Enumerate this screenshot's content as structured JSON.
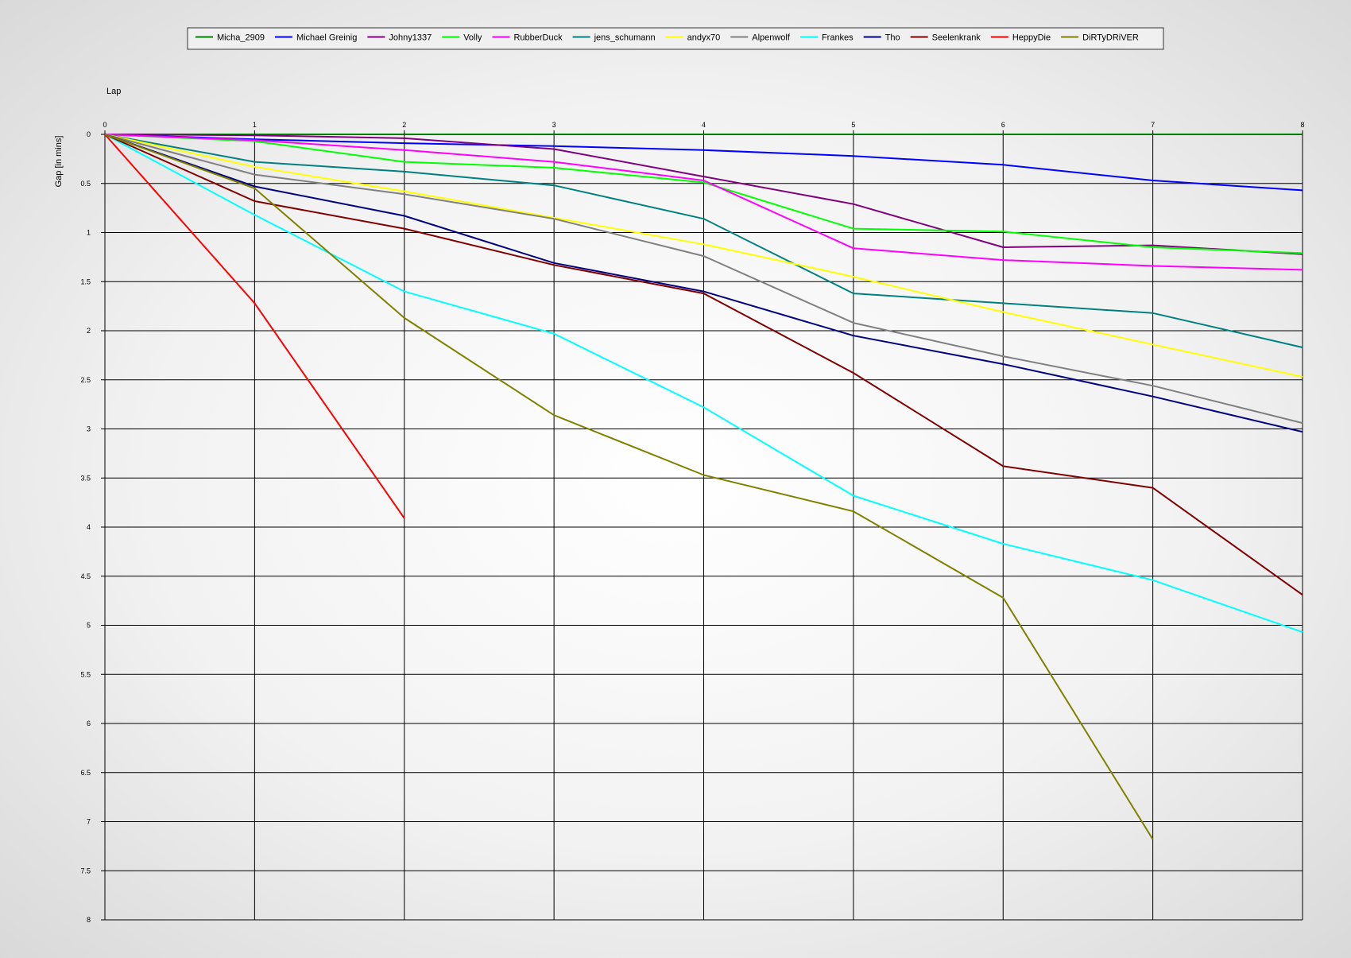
{
  "chart_data": {
    "type": "line",
    "title": "",
    "xlabel": "Lap",
    "ylabel": "Gap [in mins]",
    "xlim": [
      0,
      8
    ],
    "ylim": [
      0,
      8
    ],
    "y_inverted": true,
    "grid": true,
    "legend_position": "top-center",
    "x_ticks": [
      0,
      1,
      2,
      3,
      4,
      5,
      6,
      7,
      8
    ],
    "y_ticks": [
      0,
      0.5,
      1,
      1.5,
      2,
      2.5,
      3,
      3.5,
      4,
      4.5,
      5,
      5.5,
      6,
      6.5,
      7,
      7.5,
      8
    ],
    "series": [
      {
        "name": "Micha_2909",
        "color": "#008000",
        "x": [
          0,
          1,
          2,
          3,
          4,
          5,
          6,
          7,
          8
        ],
        "values": [
          0,
          0,
          0,
          0,
          0,
          0,
          0,
          0,
          0
        ]
      },
      {
        "name": "Michael Greinig",
        "color": "#0000ff",
        "x": [
          0,
          1,
          2,
          3,
          4,
          5,
          6,
          7,
          8
        ],
        "values": [
          0,
          0.05,
          0.09,
          0.12,
          0.16,
          0.22,
          0.31,
          0.47,
          0.57
        ]
      },
      {
        "name": "Johny1337",
        "color": "#800080",
        "x": [
          0,
          1,
          2,
          3,
          4,
          5,
          6,
          7,
          8
        ],
        "values": [
          0,
          0.01,
          0.04,
          0.15,
          0.43,
          0.71,
          1.15,
          1.13,
          1.22
        ]
      },
      {
        "name": "Volly",
        "color": "#00ff00",
        "x": [
          0,
          1,
          2,
          3,
          4,
          5,
          6,
          7,
          8
        ],
        "values": [
          0,
          0.07,
          0.28,
          0.34,
          0.49,
          0.96,
          0.99,
          1.15,
          1.21
        ]
      },
      {
        "name": "RubberDuck",
        "color": "#ff00ff",
        "x": [
          0,
          1,
          2,
          3,
          4,
          5,
          6,
          7,
          8
        ],
        "values": [
          0,
          0.06,
          0.16,
          0.28,
          0.47,
          1.16,
          1.28,
          1.34,
          1.38
        ]
      },
      {
        "name": "jens_schumann",
        "color": "#008080",
        "x": [
          0,
          1,
          2,
          3,
          4,
          5,
          6,
          7,
          8
        ],
        "values": [
          0,
          0.28,
          0.38,
          0.52,
          0.86,
          1.62,
          1.72,
          1.82,
          2.17
        ]
      },
      {
        "name": "andyx70",
        "color": "#ffff00",
        "x": [
          0,
          1,
          2,
          3,
          4,
          5,
          6,
          7,
          8
        ],
        "values": [
          0,
          0.33,
          0.58,
          0.85,
          1.12,
          1.45,
          1.81,
          2.14,
          2.47
        ]
      },
      {
        "name": "Alpenwolf",
        "color": "#808080",
        "x": [
          0,
          1,
          2,
          3,
          4,
          5,
          6,
          7,
          8
        ],
        "values": [
          0,
          0.41,
          0.61,
          0.86,
          1.24,
          1.92,
          2.26,
          2.56,
          2.94
        ]
      },
      {
        "name": "Frankes",
        "color": "#00ffff",
        "x": [
          0,
          1,
          2,
          3,
          4,
          5,
          6,
          7,
          8
        ],
        "values": [
          0,
          0.82,
          1.6,
          2.03,
          2.78,
          3.68,
          4.17,
          4.54,
          5.07
        ]
      },
      {
        "name": "Tho",
        "color": "#000080",
        "x": [
          0,
          1,
          2,
          3,
          4,
          5,
          6,
          7,
          8
        ],
        "values": [
          0,
          0.53,
          0.83,
          1.31,
          1.6,
          2.05,
          2.34,
          2.67,
          3.03
        ]
      },
      {
        "name": "Seelenkrank",
        "color": "#800000",
        "x": [
          0,
          1,
          2,
          3,
          4,
          5,
          6,
          7,
          8
        ],
        "values": [
          0,
          0.68,
          0.96,
          1.33,
          1.62,
          2.43,
          3.38,
          3.6,
          4.69
        ]
      },
      {
        "name": "HeppyDie",
        "color": "#ff0000",
        "x": [
          0,
          1,
          2
        ],
        "values": [
          0,
          1.72,
          3.91
        ]
      },
      {
        "name": "DiRTyDRiVER",
        "color": "#808000",
        "x": [
          0,
          1,
          2,
          3,
          4,
          5,
          6,
          7
        ],
        "values": [
          0,
          0.55,
          1.87,
          2.86,
          3.47,
          3.84,
          4.72,
          7.18
        ]
      }
    ]
  }
}
